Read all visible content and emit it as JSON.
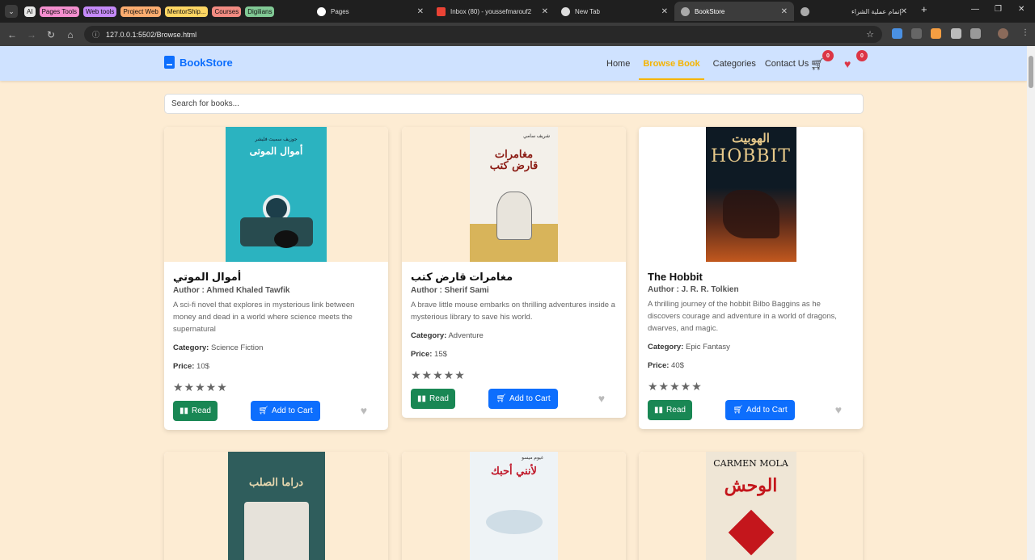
{
  "browser": {
    "tab_groups": [
      {
        "label": "AI",
        "color": "#e8e8e8"
      },
      {
        "label": "Pages Tools",
        "color": "#f48fcf"
      },
      {
        "label": "Web tools",
        "color": "#c58af9"
      },
      {
        "label": "Project Web",
        "color": "#fcad70"
      },
      {
        "label": "MentorShip...",
        "color": "#fdd663"
      },
      {
        "label": "Courses",
        "color": "#f28b82"
      },
      {
        "label": "Digilians",
        "color": "#81c995"
      }
    ],
    "tabs": [
      {
        "title": "Pages",
        "icon": "github-icon"
      },
      {
        "title": "Inbox (80) - youssefmarouf2",
        "icon": "gmail-icon"
      },
      {
        "title": "New Tab",
        "icon": "chrome-icon"
      },
      {
        "title": "BookStore",
        "icon": "globe-icon"
      },
      {
        "title": "إتمام عملية الشراء",
        "icon": "globe-icon"
      }
    ],
    "url": "127.0.0.1:5502/Browse.html"
  },
  "navbar": {
    "brand": "BookStore",
    "links": [
      "Home",
      "Browse Book",
      "Categories",
      "Contact Us"
    ],
    "active_link": "Browse Book",
    "cart_count": "0",
    "wishlist_count": "0"
  },
  "search": {
    "placeholder": "Search for books..."
  },
  "labels": {
    "category": "Category:",
    "price": "Price:",
    "read": "Read",
    "add_to_cart": "Add to Cart",
    "stars": "★★★★★"
  },
  "books": [
    {
      "title": "أموال الموتي",
      "author": "Author : Ahmed Khaled Tawfik",
      "description": "A sci-fi novel that explores in mysterious link between money and dead in a world where science meets the supernatural",
      "category": "Science Fiction",
      "price": "10$",
      "cover_title": "أموال الموتى",
      "cover_author": "جوزيف سميث فليشر"
    },
    {
      "title": "مغامرات قارض كتب",
      "author": "Author : Sherif Sami",
      "description": "A brave little mouse embarks on thrilling adventures inside a mysterious library to save his world.",
      "category": "Adventure",
      "price": "15$",
      "cover_title": "مغامرات قارض كتب",
      "cover_author": "شريف سامي"
    },
    {
      "title": "The Hobbit",
      "author": "Author : J. R. R. Tolkien",
      "description": "A thrilling journey of the hobbit Bilbo Baggins as he discovers courage and adventure in a world of dragons, dwarves, and magic.",
      "category": "Epic Fantasy",
      "price": "40$",
      "cover_title": "الهوبيت",
      "cover_author": "HOBBIT"
    },
    {
      "cover_title": "دراما الصلب"
    },
    {
      "cover_title": "لأنني أحبك",
      "cover_author": "غيوم ميسو"
    },
    {
      "cover_title": "الوحش",
      "cover_author": "CARMEN MOLA"
    }
  ]
}
